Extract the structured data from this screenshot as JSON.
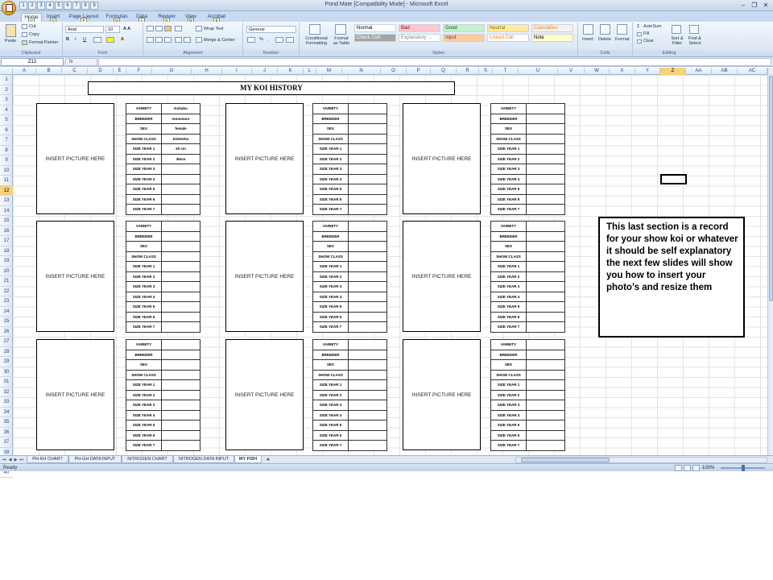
{
  "window": {
    "title": "Pond Mate  [Compatibility Mode] - Microsoft Excel",
    "controls": {
      "minimize": "–",
      "restore": "❐",
      "close": "✕"
    }
  },
  "qat": {
    "keytips": [
      "1",
      "2",
      "3",
      "4",
      "5",
      "6",
      "7",
      "8",
      "9"
    ]
  },
  "ribbon": {
    "tabs": [
      {
        "label": "Home",
        "keytip": "H"
      },
      {
        "label": "Insert",
        "keytip": "N"
      },
      {
        "label": "Page Layout",
        "keytip": "P"
      },
      {
        "label": "Formulas",
        "keytip": "M"
      },
      {
        "label": "Data",
        "keytip": "A"
      },
      {
        "label": "Review",
        "keytip": "R"
      },
      {
        "label": "View",
        "keytip": "W"
      },
      {
        "label": "Acrobat",
        "keytip": "B"
      }
    ],
    "clipboard": {
      "paste": "Paste",
      "cut": "Cut",
      "copy": "Copy",
      "format_painter": "Format Painter",
      "label": "Clipboard"
    },
    "font": {
      "name": "Arial",
      "size": "10",
      "label": "Font"
    },
    "alignment": {
      "wrap_text": "Wrap Text",
      "merge_center": "Merge & Center",
      "label": "Alignment"
    },
    "number": {
      "format": "General",
      "label": "Number"
    },
    "styles": {
      "conditional": "Conditional Formatting",
      "format_table": "Format as Table",
      "cells": [
        {
          "label": "Normal",
          "bg": "#ffffff",
          "fg": "#000000"
        },
        {
          "label": "Bad",
          "bg": "#ffc7ce",
          "fg": "#9c0006"
        },
        {
          "label": "Good",
          "bg": "#c6efce",
          "fg": "#006100"
        },
        {
          "label": "Neutral",
          "bg": "#ffeb9c",
          "fg": "#9c6500"
        },
        {
          "label": "Calculation",
          "bg": "#f2f2f2",
          "fg": "#fa7d00"
        },
        {
          "label": "Check Cell",
          "bg": "#a5a5a5",
          "fg": "#ffffff"
        },
        {
          "label": "Explanatory ...",
          "bg": "#ffffff",
          "fg": "#7f7f7f"
        },
        {
          "label": "Input",
          "bg": "#ffcc99",
          "fg": "#3f3f76"
        },
        {
          "label": "Linked Cell",
          "bg": "#ffffff",
          "fg": "#fa7d00"
        },
        {
          "label": "Note",
          "bg": "#ffffcc",
          "fg": "#000000"
        }
      ],
      "label": "Styles"
    },
    "cells_group": {
      "insert": "Insert",
      "delete": "Delete",
      "format": "Format",
      "label": "Cells"
    },
    "editing": {
      "autosum": "AutoSum",
      "fill": "Fill",
      "clear": "Clear",
      "sort_filter": "Sort & Filter",
      "find_select": "Find & Select",
      "label": "Editing"
    }
  },
  "formula_bar": {
    "name_box": "Z12",
    "fx": "fx",
    "value": ""
  },
  "columns": [
    "A",
    "B",
    "C",
    "D",
    "E",
    "F",
    "G",
    "H",
    "I",
    "J",
    "K",
    "L",
    "M",
    "N",
    "O",
    "P",
    "Q",
    "R",
    "S",
    "T",
    "U",
    "V",
    "W",
    "X",
    "Y",
    "Z",
    "AA",
    "AB",
    "AC"
  ],
  "active_column": "Z",
  "active_row": 12,
  "rows": [
    "1",
    "2",
    "3",
    "4",
    "5",
    "6",
    "7",
    "8",
    "9",
    "10",
    "11",
    "12",
    "13",
    "14",
    "15",
    "16",
    "17",
    "18",
    "19",
    "20",
    "21",
    "22",
    "23",
    "24",
    "25",
    "26",
    "27",
    "28",
    "29",
    "30",
    "31",
    "32",
    "33",
    "34",
    "35",
    "36",
    "37",
    "38",
    "39",
    "40"
  ],
  "sheet": {
    "title": "MY KOI HISTORY",
    "picture_placeholder": "INSERT PICTURE HERE",
    "record_labels": [
      "VARIETY",
      "BREEDER",
      "SEX",
      "SHOW CLASS",
      "SIZE YEAR 1",
      "SIZE YEAR 2",
      "SIZE YEAR 3",
      "SIZE YEAR 4",
      "SIZE YEAR 5",
      "SIZE YEAR 6",
      "SIZE YEAR 7"
    ],
    "first_record_values": [
      "Kohaku",
      "momotaro",
      "female",
      "KOHAKU",
      "20 cm",
      "35cm",
      "",
      "",
      "",
      "",
      ""
    ],
    "note": "This last section is a record for your show koi or whatever  it should be self explanatory  the next few slides will show you how to insert your photo’s and resize them"
  },
  "sheet_tabs": [
    "PH-KH CHART",
    "PH-GH DATA INPUT",
    "NITROGEN  CHART",
    "NITROGEN DATA INPUT",
    "MY FISH"
  ],
  "active_sheet": "MY FISH",
  "status": {
    "text": "Ready",
    "zoom": "100%",
    "zoom_value": 100
  }
}
